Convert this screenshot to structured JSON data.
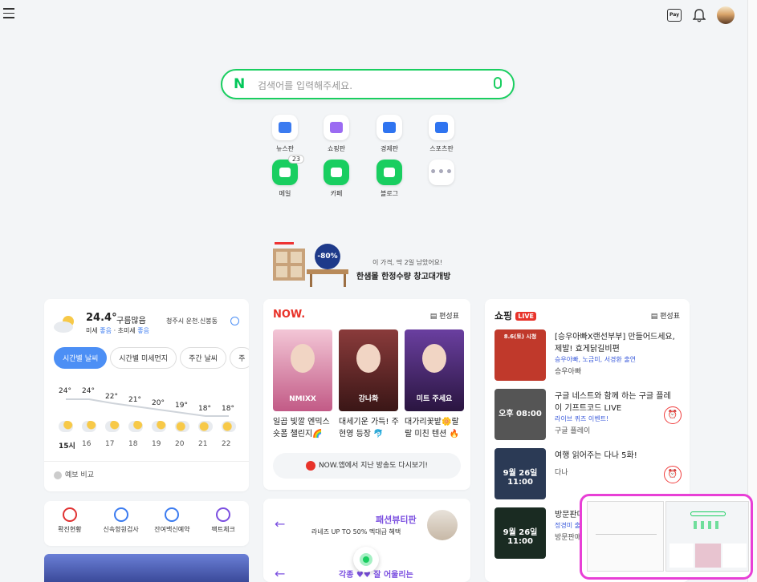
{
  "search": {
    "placeholder": "검색어를 입력해주세요.",
    "logo": "N"
  },
  "shortcuts": [
    {
      "label": "뉴스판",
      "icon": "news-icon",
      "color": "#3b7bf0"
    },
    {
      "label": "쇼핑판",
      "icon": "shopping-icon",
      "color": "#9b6bf2"
    },
    {
      "label": "경제판",
      "icon": "economy-icon",
      "color": "#2f74f0"
    },
    {
      "label": "스포츠판",
      "icon": "sports-icon",
      "color": "#2f74f0"
    },
    {
      "label": "메일",
      "icon": "mail-icon",
      "color": "#19ce60",
      "badge": "23"
    },
    {
      "label": "카페",
      "icon": "cafe-icon",
      "color": "#19ce60"
    },
    {
      "label": "블로그",
      "icon": "blog-icon",
      "color": "#19ce60"
    },
    {
      "label": "",
      "icon": "more-icon",
      "color": "#aab"
    }
  ],
  "ad": {
    "badge": "-80%",
    "line1": "이 가격, 딱 2일 남았어요!",
    "line2": "한샘몰 한정수량 창고대개방"
  },
  "weather": {
    "temp": "24.4°",
    "condition": "구름많음",
    "location": "청주시 운천.신봉동",
    "dust_prefix": "미세",
    "dust": "좋음",
    "ultra_prefix": "· 초미세",
    "ultra": "좋음",
    "tabs": [
      "시간별 날씨",
      "시간별 미세먼지",
      "주간 날씨",
      "주"
    ],
    "hourly": [
      {
        "hour": "15시",
        "temp": "24°"
      },
      {
        "hour": "16",
        "temp": "24°"
      },
      {
        "hour": "17",
        "temp": "22°"
      },
      {
        "hour": "18",
        "temp": "21°"
      },
      {
        "hour": "19",
        "temp": "20°"
      },
      {
        "hour": "20",
        "temp": "19°"
      },
      {
        "hour": "21",
        "temp": "18°"
      },
      {
        "hour": "22",
        "temp": "18°"
      }
    ],
    "compare": "예보 비교"
  },
  "covid": [
    "확진현황",
    "신속항원검사",
    "잔여백신예약",
    "팩트체크"
  ],
  "now": {
    "logo": "NOW.",
    "schedule": "편성표",
    "items": [
      {
        "caption": "일곱 빛깔 엔믹스 숏폼 챌린지🌈",
        "thumb_text": "NMIXX"
      },
      {
        "caption": "대세기운 가득! 주현영 등장 🐬",
        "thumb_text": "강나화"
      },
      {
        "caption": "대가리꽃밭🌼랄랄 미친 텐션 🔥",
        "thumb_text": "미트 주세요"
      }
    ],
    "footer": "NOW.앱에서 지난 방송도 다시보기!"
  },
  "fashion": {
    "title": "패션뷰티판",
    "subtitle": "라네즈 UP TO 50% 멕대급 혜택",
    "next": "각종 ♥♥ 잘 어울리는"
  },
  "shopping": {
    "title": "쇼핑",
    "live": "LIVE",
    "schedule": "편성표",
    "items": [
      {
        "title": "[승우아빠X랜선부부] 만들어드세요, 제발! 효게닭길비편",
        "sub": "승우아빠, 노금미, 서경환 출연",
        "seller": "승우아빠",
        "thumb_label": "8.6(토) 시청",
        "thumb_bg": "#c0392b"
      },
      {
        "title": "구글 네스트와 함께 하는 구글 플레이 기프트코드 LIVE",
        "sub": "라이브 퀴즈 이벤트!",
        "seller": "구글 플레이",
        "thumb_label": "오후 08:00",
        "thumb_bg": "#555"
      },
      {
        "title": "여행 읽어주는 다나 5화!",
        "sub": "",
        "seller": "다나",
        "thumb_label": "9월 26일 11:00",
        "thumb_bg": "#2b3a55"
      },
      {
        "title": "방문판매 왔습니다",
        "sub": "정경미 출연",
        "seller": "방문판매",
        "thumb_label": "9월 26일 11:00",
        "thumb_bg": "#1a2b22"
      }
    ]
  }
}
